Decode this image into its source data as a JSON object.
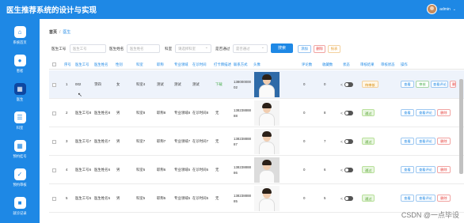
{
  "app": {
    "title": "医生推荐系统的设计与实现",
    "user": "admin"
  },
  "sidebar": {
    "items": [
      {
        "label": "系统首页",
        "icon": "home-icon",
        "glyph": "⌂",
        "active": false
      },
      {
        "label": "患者",
        "icon": "user-icon",
        "glyph": "●",
        "active": false
      },
      {
        "label": "医生",
        "icon": "grid-icon",
        "glyph": "▦",
        "active": true
      },
      {
        "label": "科室",
        "icon": "list-icon",
        "glyph": "☰",
        "active": false
      },
      {
        "label": "预约挂号",
        "icon": "apps-icon",
        "glyph": "▦",
        "active": false
      },
      {
        "label": "预约审核",
        "icon": "clipboard-icon",
        "glyph": "✓",
        "active": false
      },
      {
        "label": "就诊记录",
        "icon": "video-icon",
        "glyph": "■",
        "active": false
      }
    ]
  },
  "breadcrumb": {
    "home": "首页",
    "current": "医生"
  },
  "filters": {
    "doctor_no_label": "医生工号",
    "doctor_no_placeholder": "医生工号",
    "doctor_name_label": "医生姓名",
    "doctor_name_placeholder": "医生姓名",
    "dept_label": "科室",
    "dept_placeholder": "请选择科室",
    "approved_label": "是否通过",
    "approved_placeholder": "是否通过",
    "search": "搜索",
    "add": "添加",
    "delete": "删除",
    "report": "报表"
  },
  "table": {
    "headers": [
      "序号",
      "医生工号",
      "医生姓名",
      "性别",
      "科室",
      "职称",
      "专业领域",
      "在诊时间",
      "打卡牌描述",
      "联系方式",
      "头像",
      "评论数",
      "收藏数",
      "状态",
      "审核结果",
      "审核状态",
      "操作"
    ],
    "rows": [
      {
        "no": "1",
        "doctor_no": "002",
        "name": "李四",
        "gender": "女",
        "dept": "科室4",
        "title": "测试",
        "field": "测试",
        "time": "测试",
        "desc": "下载",
        "phone": "13800000002",
        "comments": "0",
        "favs": "0",
        "share": "<",
        "status": "待审核",
        "status_type": "wait",
        "actions": [
          "查看",
          "审核",
          "查看评论",
          "删"
        ],
        "highlight": true
      },
      {
        "no": "2",
        "doctor_no": "医生工号8",
        "name": "医生姓名8",
        "gender": "男",
        "dept": "科室8",
        "title": "职称8",
        "field": "专业领域8",
        "time": "在诊时间8",
        "desc": "无",
        "phone": "13823888888",
        "comments": "0",
        "favs": "8",
        "share": "<",
        "status": "通过",
        "status_type": "pass",
        "actions": [
          "查看",
          "查看评论",
          "删除"
        ],
        "highlight": false
      },
      {
        "no": "3",
        "doctor_no": "医生工号7",
        "name": "医生姓名7",
        "gender": "男",
        "dept": "科室7",
        "title": "职称7",
        "field": "专业领域7",
        "time": "在诊时间7",
        "desc": "无",
        "phone": "13823888887",
        "comments": "0",
        "favs": "7",
        "share": "<",
        "status": "通过",
        "status_type": "pass",
        "actions": [
          "查看",
          "查看评论",
          "删除"
        ],
        "highlight": false
      },
      {
        "no": "4",
        "doctor_no": "医生工号6",
        "name": "医生姓名6",
        "gender": "男",
        "dept": "科室6",
        "title": "职称6",
        "field": "专业领域6",
        "time": "在诊时间6",
        "desc": "无",
        "phone": "13823888886",
        "comments": "0",
        "favs": "6",
        "share": "<",
        "status": "通过",
        "status_type": "pass",
        "actions": [
          "查看",
          "查看评论",
          "删除"
        ],
        "highlight": false
      },
      {
        "no": "5",
        "doctor_no": "医生工号5",
        "name": "医生姓名5",
        "gender": "男",
        "dept": "科室5",
        "title": "职称5",
        "field": "专业领域5",
        "time": "在诊时间5",
        "desc": "无",
        "phone": "13823888885",
        "comments": "0",
        "favs": "5",
        "share": "<",
        "status": "通过",
        "status_type": "pass",
        "actions": [
          "查看",
          "查看评论",
          "删除"
        ],
        "highlight": false
      }
    ]
  },
  "watermark": "CSDN @一点毕设",
  "colors": {
    "primary": "#1e88e5",
    "danger": "#e53935",
    "success": "#4caf50"
  }
}
